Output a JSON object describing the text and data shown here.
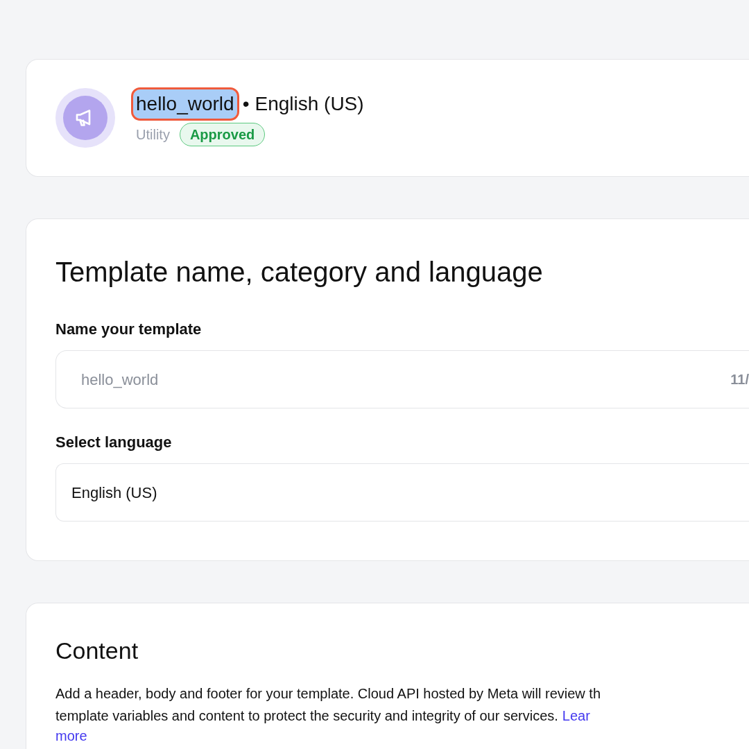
{
  "summary": {
    "name": "hello_world",
    "name_highlighted": true,
    "separator": "•",
    "language": "English (US)",
    "category": "Utility",
    "status": "Approved"
  },
  "details": {
    "title": "Template name, category and language",
    "name_label": "Name your template",
    "name_value": "hello_world",
    "name_counter": "11/",
    "language_label": "Select language",
    "language_value": "English (US)"
  },
  "content": {
    "title": "Content",
    "description_lines": [
      "Add a header, body and footer for your template. Cloud API hosted by Meta will review th",
      "template variables and content to protect the security and integrity of our services."
    ],
    "link_parts": [
      "Lear",
      "more"
    ]
  }
}
